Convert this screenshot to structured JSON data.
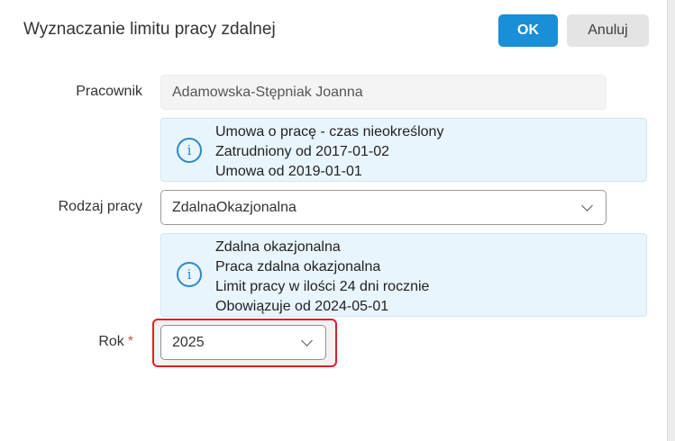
{
  "dialog": {
    "title": "Wyznaczanie limitu pracy zdalnej",
    "ok_label": "OK",
    "cancel_label": "Anuluj"
  },
  "employee": {
    "label": "Pracownik",
    "value": "Adamowska-Stępniak Joanna"
  },
  "employment_info": {
    "lines": [
      "Umowa o pracę - czas nieokreślony",
      "Zatrudniony od 2017-01-02",
      "Umowa od 2019-01-01"
    ]
  },
  "work_type": {
    "label": "Rodzaj pracy",
    "value": "ZdalnaOkazjonalna"
  },
  "work_type_info": {
    "lines": [
      "Zdalna okazjonalna",
      "Praca zdalna okazjonalna",
      "Limit pracy w ilości 24 dni rocznie",
      "Obowiązuje od 2024-05-01"
    ]
  },
  "year": {
    "label": "Rok",
    "required_mark": "*",
    "value": "2025"
  },
  "colors": {
    "primary": "#1a8ed6",
    "info_bg": "#e9f5fc",
    "info_icon": "#2c88c8",
    "highlight": "#e01e25",
    "required": "#d9534f"
  },
  "icons": {
    "info": "info-circle-icon",
    "dropdown": "chevron-down-icon"
  }
}
